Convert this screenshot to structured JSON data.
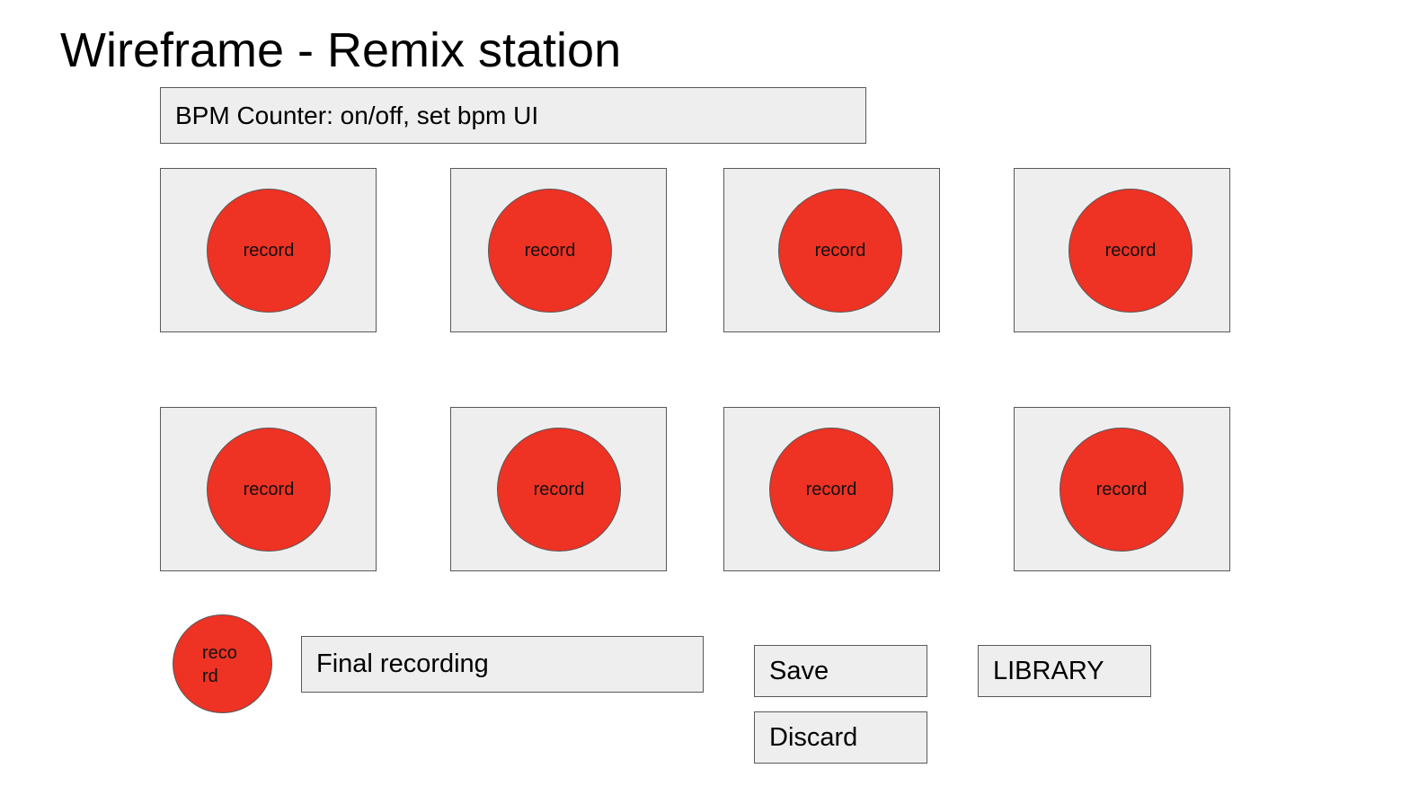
{
  "title": "Wireframe - Remix station",
  "bpm_counter": {
    "label": "BPM Counter: on/off, set bpm UI"
  },
  "tracks": [
    {
      "record_label": "record"
    },
    {
      "record_label": "record"
    },
    {
      "record_label": "record"
    },
    {
      "record_label": "record"
    },
    {
      "record_label": "record"
    },
    {
      "record_label": "record"
    },
    {
      "record_label": "record"
    },
    {
      "record_label": "record"
    }
  ],
  "final": {
    "record_label_line1": "reco",
    "record_label_line2": "rd",
    "recording_label": "Final recording"
  },
  "actions": {
    "save_label": "Save",
    "discard_label": "Discard",
    "library_label": "LIBRARY"
  },
  "colors": {
    "record_button": "#ee3224",
    "panel": "#eeeeee",
    "border": "#595959"
  }
}
